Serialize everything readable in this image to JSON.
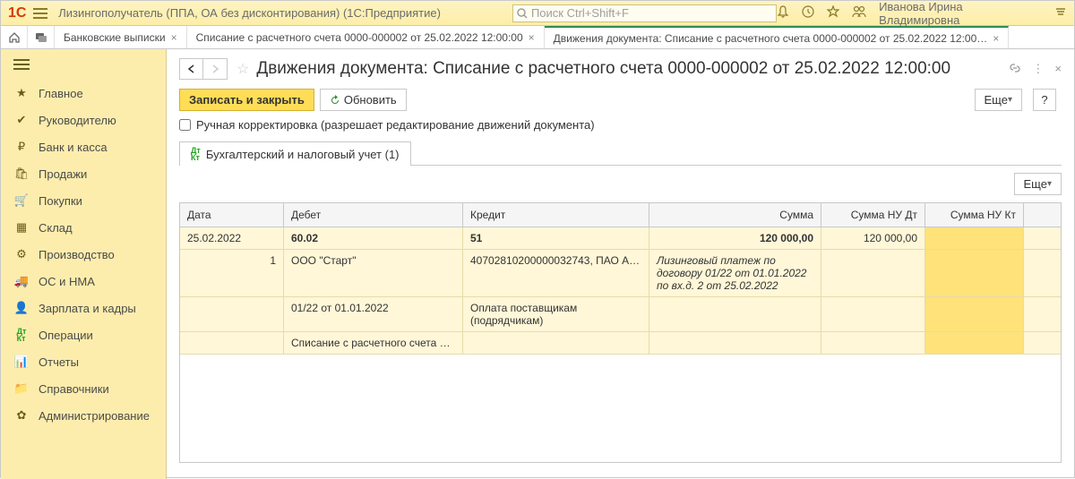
{
  "titlebar": {
    "app_title": "Лизингополучатель (ППА, ОА без дисконтирования)  (1С:Предприятие)",
    "search_placeholder": "Поиск Ctrl+Shift+F",
    "user": "Иванова Ирина Владимировна"
  },
  "tabs": {
    "t1": "Банковские выписки",
    "t2": "Списание с расчетного счета 0000-000002 от 25.02.2022 12:00:00",
    "t3": "Движения документа: Списание с расчетного счета 0000-000002 от 25.02.2022 12:00…"
  },
  "sidebar": {
    "main": "Главное",
    "manager": "Руководителю",
    "bank": "Банк и касса",
    "sales": "Продажи",
    "purch": "Покупки",
    "stock": "Склад",
    "prod": "Производство",
    "os": "ОС и НМА",
    "salary": "Зарплата и кадры",
    "ops": "Операции",
    "reports": "Отчеты",
    "ref": "Справочники",
    "admin": "Администрирование"
  },
  "content": {
    "title": "Движения документа: Списание с расчетного счета 0000-000002 от 25.02.2022 12:00:00",
    "save_close": "Записать и закрыть",
    "refresh": "Обновить",
    "more": "Еще",
    "help": "?",
    "manual_edit": "Ручная корректировка (разрешает редактирование движений документа)",
    "tab_label": "Бухгалтерский и налоговый учет (1)"
  },
  "grid": {
    "h_date": "Дата",
    "h_debit": "Дебет",
    "h_credit": "Кредит",
    "h_sum": "Сумма",
    "h_nud": "Сумма НУ Дт",
    "h_nuk": "Сумма НУ Кт",
    "r1": {
      "date": "25.02.2022",
      "num": "1",
      "debit": "60.02",
      "credit": "51",
      "sum": "120 000,00",
      "nud": "120 000,00"
    },
    "r2": {
      "debit": "ООО \"Старт\"",
      "credit": "40702810200000032743, ПАО А…",
      "desc": "Лизинговый платеж по договору 01/22 от 01.01.2022 по вх.д. 2 от 25.02.2022"
    },
    "r3": {
      "debit": "01/22 от 01.01.2022",
      "credit": "Оплата поставщикам (подрядчикам)"
    },
    "r4": {
      "debit": "Списание с расчетного счета …"
    }
  }
}
